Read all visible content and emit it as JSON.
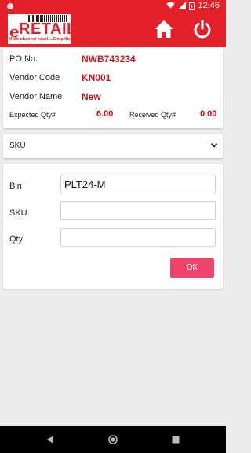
{
  "status_bar": {
    "time": "12:46"
  },
  "app_bar": {
    "logo_text": "RETAIL",
    "logo_e": "e",
    "logo_tagline": "Multi-channel retail....Simplified",
    "home_icon": "home-icon",
    "power_icon": "power-icon"
  },
  "info": {
    "po_label": "PO No.",
    "po_value": "NWB743234",
    "vendor_code_label": "Vendor Code",
    "vendor_code_value": "KN001",
    "vendor_name_label": "Vendor Name",
    "vendor_name_value": "New",
    "expected_label": "Expected Qty#",
    "expected_value": "6.00",
    "received_label": "Received Qty#",
    "received_value": "0.00"
  },
  "sku_dropdown": {
    "selected": "SKU"
  },
  "form": {
    "bin_label": "Bin",
    "bin_value": "PLT24-M",
    "sku_label": "SKU",
    "sku_value": "",
    "qty_label": "Qty",
    "qty_value": "",
    "ok_label": "OK"
  },
  "colors": {
    "accent": "#e2202a",
    "value_red": "#c8161d",
    "button_pink": "#f0426a"
  }
}
